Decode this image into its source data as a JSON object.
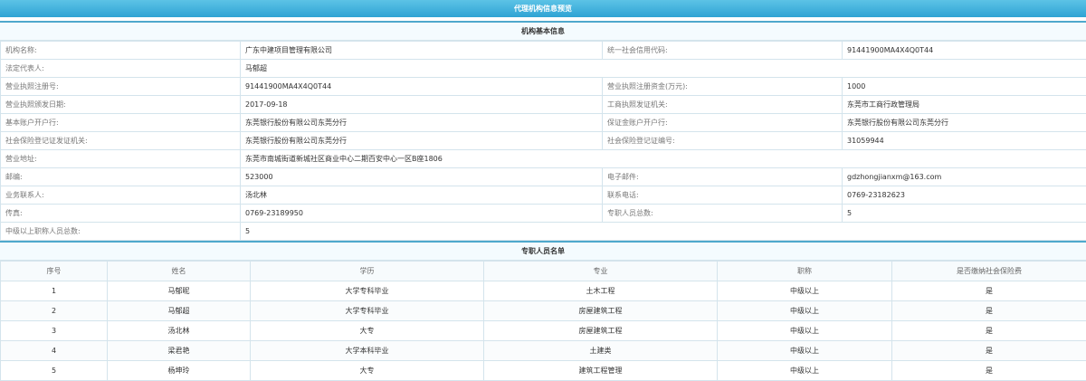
{
  "page_title": "代理机构信息预览",
  "basic_section_title": "机构基本信息",
  "basic_rows": [
    {
      "l1": "机构名称:",
      "v1": "广东中建项目管理有限公司",
      "l2": "统一社会信用代码:",
      "v2": "91441900MA4X4Q0T44"
    },
    {
      "l1": "法定代表人:",
      "v1": "马郁超"
    },
    {
      "l1": "营业执照注册号:",
      "v1": "91441900MA4X4Q0T44",
      "l2": "营业执照注册资金(万元):",
      "v2": "1000"
    },
    {
      "l1": "营业执照颁发日期:",
      "v1": "2017-09-18",
      "l2": "工商执照发证机关:",
      "v2": "东莞市工商行政管理局"
    },
    {
      "l1": "基本账户开户行:",
      "v1": "东莞银行股份有限公司东莞分行",
      "l2": "保证金账户开户行:",
      "v2": "东莞银行股份有限公司东莞分行"
    },
    {
      "l1": "社会保险登记证发证机关:",
      "v1": " 东莞银行股份有限公司东莞分行",
      "l2": "社会保险登记证编号:",
      "v2": "31059944"
    },
    {
      "l1": "营业地址:",
      "v1": "东莞市南城街道新城社区商业中心二期百安中心一区B座1806"
    },
    {
      "l1": "邮编:",
      "v1": "523000",
      "l2": "电子邮件:",
      "v2": "gdzhongjianxm@163.com"
    },
    {
      "l1": "业务联系人:",
      "v1": "汤北林",
      "l2": "联系电话:",
      "v2": "0769-23182623"
    },
    {
      "l1": "传真:",
      "v1": "0769-23189950",
      "l2": "专职人员总数:",
      "v2": "5"
    },
    {
      "l1": "中级以上职称人员总数:",
      "v1": "5"
    }
  ],
  "staff_section_title": "专职人员名单",
  "staff_headers": [
    "序号",
    "姓名",
    "学历",
    "专业",
    "职称",
    "是否缴纳社会保险费"
  ],
  "staff_rows": [
    [
      "1",
      "马郁昵",
      "大学专科毕业",
      "土木工程",
      "中级以上",
      "是"
    ],
    [
      "2",
      "马郁超",
      "大学专科毕业",
      "房屋建筑工程",
      "中级以上",
      "是"
    ],
    [
      "3",
      "汤北林",
      "大专",
      "房屋建筑工程",
      "中级以上",
      "是"
    ],
    [
      "4",
      "梁君艳",
      "大学本科毕业",
      "土建类",
      "中级以上",
      "是"
    ],
    [
      "5",
      "杨坤玲",
      "大专",
      "建筑工程管理",
      "中级以上",
      "是"
    ]
  ]
}
